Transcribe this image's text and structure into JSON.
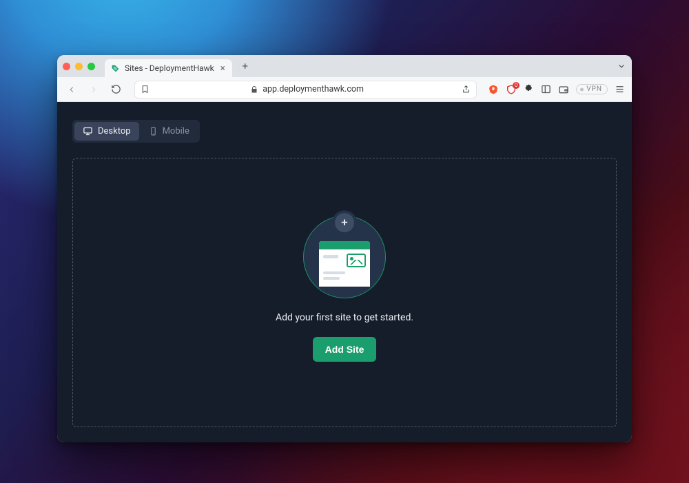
{
  "browser": {
    "tab": {
      "title": "Sites - DeploymentHawk",
      "favicon_color": "#17a673"
    },
    "address": "app.deploymenthawk.com",
    "shield_badge_count": "0",
    "vpn_label": "VPN"
  },
  "app": {
    "view_tabs": {
      "desktop": "Desktop",
      "mobile": "Mobile",
      "active": "desktop"
    },
    "empty_state": {
      "message": "Add your first site to get started.",
      "cta": "Add Site"
    }
  }
}
